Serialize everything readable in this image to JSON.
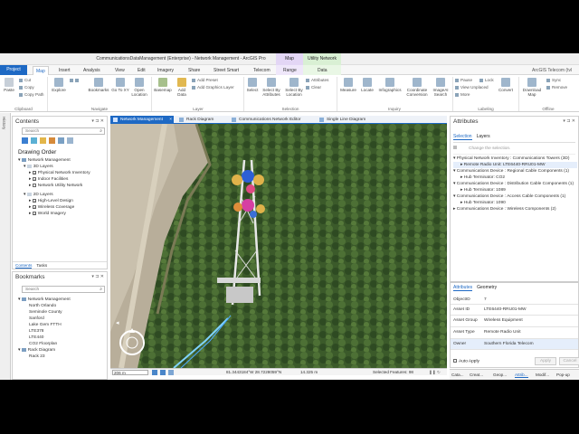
{
  "window": {
    "title": "CommunicationsDataManagement (Enterprise) - Network Management - ArcGIS Pro",
    "context_map": "Map",
    "context_un": "Utility Network"
  },
  "tabs": {
    "project": "Project",
    "items": [
      "Map",
      "Insert",
      "Analysis",
      "View",
      "Edit",
      "Imagery",
      "Share",
      "Street Smart",
      "Telecom",
      "Range",
      "Data"
    ],
    "active": "Map",
    "user": "ArcGIS Telecom (tvl Telecom Portal)"
  },
  "ribbon": {
    "clipboard": {
      "paste": "Paste",
      "cut": "Cut",
      "copy": "Copy",
      "copy_path": "Copy Path",
      "label": "Clipboard"
    },
    "navigate": {
      "explore": "Explore",
      "bookmarks": "Bookmarks",
      "go_to_xy": "Go To XY",
      "open_location": "Open Location",
      "label": "Navigate"
    },
    "layer": {
      "basemap": "Basemap",
      "add_data": "Add Data",
      "add_preset": "Add Preset",
      "add_graphics": "Add Graphics Layer",
      "label": "Layer"
    },
    "selection": {
      "select": "Select",
      "by_attributes": "Select By Attributes",
      "by_location": "Select By Location",
      "attributes": "Attributes",
      "clear": "Clear",
      "label": "Selection"
    },
    "inquiry": {
      "measure": "Measure",
      "locate": "Locate",
      "infographics": "Infographics",
      "coordinate": "Coordinate Conversion",
      "image_search": "ImageAI Search",
      "label": "Inquiry"
    },
    "labeling": {
      "pause": "Pause",
      "lock": "Lock",
      "view_unplaced": "View Unplaced",
      "more": "More",
      "convert": "Convert",
      "label": "Labeling"
    },
    "offline": {
      "download": "Download Map",
      "sync": "Sync",
      "remove": "Remove",
      "label": "Offline"
    }
  },
  "history_tab": "History",
  "contents": {
    "title": "Contents",
    "search_placeholder": "Search",
    "drawing_order": "Drawing Order",
    "map_name": "Network Management",
    "group_3d": "3D Layers",
    "layers_3d": [
      "Physical Network Inventory",
      "Indoor Facilities",
      "Network Utility Network"
    ],
    "layers_3d_checked": [
      true,
      true,
      false
    ],
    "group_2d": "2D Layers",
    "layers_2d": [
      "High-Level Design",
      "Wireless Coverage",
      "World Imagery"
    ],
    "tabs": [
      "Contents",
      "Tasks"
    ]
  },
  "bookmarks": {
    "title": "Bookmarks",
    "search_placeholder": "Search",
    "group1": "Network Management",
    "items1": [
      "North Orlando",
      "Seminole County",
      "Sanford",
      "Lake Gem FTTH",
      "LTE378",
      "LTE440",
      "CO2 Floorplan"
    ],
    "group2": "Rack Diagram",
    "items2": [
      "Rack 23"
    ]
  },
  "map_tabs": [
    "Network Management",
    "Rack Diagram",
    "Communications Network Editor",
    "Single Line Diagram"
  ],
  "map_status": {
    "scale": "206 m",
    "coords": "81.3443184°W 28.7228059°N",
    "elev": "14.325 m",
    "selected": "Selected Features: 98"
  },
  "attributes": {
    "title": "Attributes",
    "tabs": [
      "Selection",
      "Layers"
    ],
    "hint": "Change the selection.",
    "tree": [
      {
        "label": "Physical Network Inventory : Communications Towers (3D)",
        "child": "Remote Radio Unit: LTE6440-RRU01-MW"
      },
      {
        "label": "Communications Device : Regional Cable Components (1)",
        "child": "Hub Terminator: CO2"
      },
      {
        "label": "Communications Device : Distribution Cable Components (1)",
        "child": "Hub Terminator: 1089"
      },
      {
        "label": "Communications Device : Access Cable Components (1)",
        "child": "Hub Terminator: 1090"
      },
      {
        "label": "Communications Device : Wireless Components (2)",
        "child": ""
      }
    ],
    "sub_tabs": [
      "Attributes",
      "Geometry"
    ],
    "fields": [
      {
        "k": "ObjectID",
        "v": "7"
      },
      {
        "k": "Asset ID",
        "v": "LTE6440-RRU01-MW"
      },
      {
        "k": "Asset Group",
        "v": "Wireless Equipment"
      },
      {
        "k": "Asset Type",
        "v": "Remote Radio Unit"
      },
      {
        "k": "Owner",
        "v": "Southern Florida Telecom"
      }
    ],
    "auto_apply": "Auto Apply",
    "apply": "Apply",
    "cancel": "Cancel"
  },
  "bottom_tabs": [
    "Cata...",
    "Creat...",
    "Geop...",
    "Attrib...",
    "Modif...",
    "Pop-up"
  ]
}
